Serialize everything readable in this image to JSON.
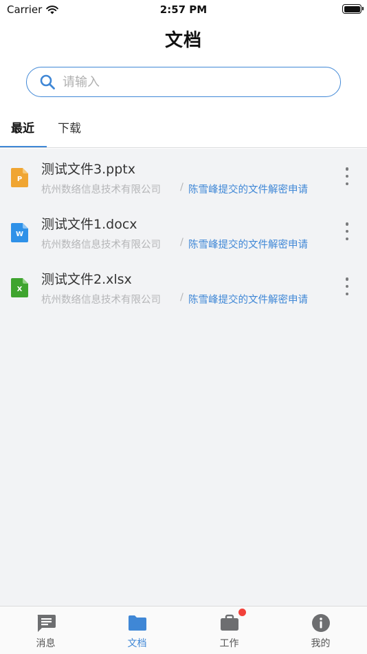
{
  "status_bar": {
    "carrier": "Carrier",
    "time": "2:57 PM"
  },
  "header": {
    "title": "文档"
  },
  "search": {
    "placeholder": "请输入",
    "value": ""
  },
  "tabs": [
    {
      "label": "最近",
      "active": true
    },
    {
      "label": "下载",
      "active": false
    }
  ],
  "files": [
    {
      "name": "测试文件3.pptx",
      "company": "杭州数络信息技术有限公司",
      "separator": "/",
      "link": "陈雪峰提交的文件解密申请",
      "type_letter": "P",
      "color": "#f0a532",
      "icon": "ppt-file-icon"
    },
    {
      "name": "测试文件1.docx",
      "company": "杭州数络信息技术有限公司",
      "separator": "/",
      "link": "陈雪峰提交的文件解密申请",
      "type_letter": "W",
      "color": "#2f91e8",
      "icon": "word-file-icon"
    },
    {
      "name": "测试文件2.xlsx",
      "company": "杭州数络信息技术有限公司",
      "separator": "/",
      "link": "陈雪峰提交的文件解密申请",
      "type_letter": "X",
      "color": "#3fa42f",
      "icon": "excel-file-icon"
    }
  ],
  "tabbar": [
    {
      "label": "消息",
      "icon": "message-icon",
      "active": false
    },
    {
      "label": "文档",
      "icon": "folder-icon",
      "active": true
    },
    {
      "label": "工作",
      "icon": "briefcase-icon",
      "active": false,
      "badge": true
    },
    {
      "label": "我的",
      "icon": "info-icon",
      "active": false
    }
  ],
  "colors": {
    "accent": "#3f87d6",
    "badge": "#f2413a",
    "inactive_icon": "#6d6e70"
  }
}
